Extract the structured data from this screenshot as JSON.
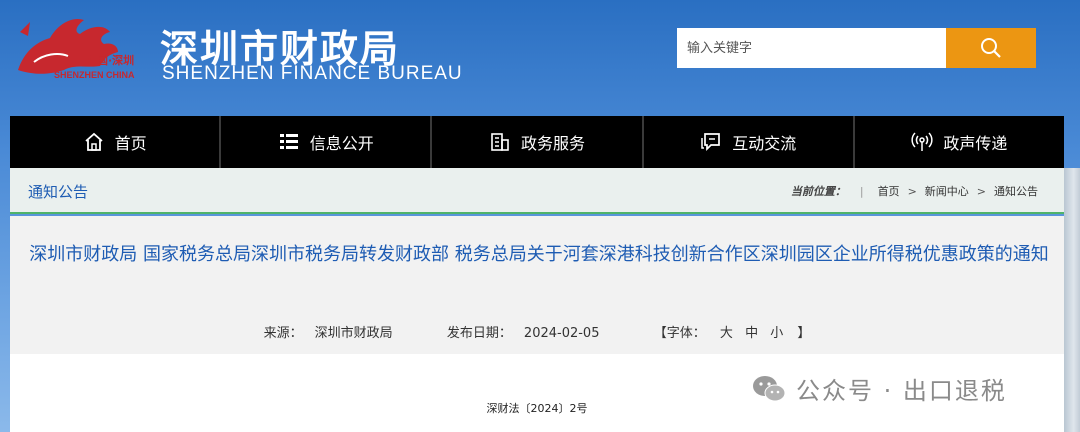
{
  "header": {
    "logo_text_cn": "中国·深圳",
    "logo_text_en": "SHENZHEN CHINA",
    "title_cn": "深圳市财政局",
    "title_en": "SHENZHEN FINANCE BUREAU"
  },
  "search": {
    "placeholder": "输入关键字",
    "button_icon": "search-icon"
  },
  "nav": {
    "items": [
      {
        "label": "首页",
        "icon": "home-icon"
      },
      {
        "label": "信息公开",
        "icon": "list-icon"
      },
      {
        "label": "政务服务",
        "icon": "building-icon"
      },
      {
        "label": "互动交流",
        "icon": "chat-icon"
      },
      {
        "label": "政声传递",
        "icon": "broadcast-icon"
      }
    ]
  },
  "breadcrumb": {
    "section_title": "通知公告",
    "label": "当前位置：",
    "items": [
      "首页",
      "新闻中心",
      "通知公告"
    ],
    "separator": ">"
  },
  "article": {
    "title": "深圳市财政局 国家税务总局深圳市税务局转发财政部 税务总局关于河套深港科技创新合作区深圳园区企业所得税优惠政策的通知",
    "source_label": "来源：",
    "source": "深圳市财政局",
    "date_label": "发布日期：",
    "date": "2024-02-05",
    "font_open": "【字体：",
    "font_sizes": [
      "大",
      "中",
      "小"
    ],
    "font_close": "】",
    "doc_number": "深财法〔2024〕2号"
  },
  "watermark": {
    "text": "公众号 · 出口退税"
  },
  "colors": {
    "link_blue": "#1e5cb3",
    "search_orange": "#ec9612",
    "nav_black": "#000000",
    "accent_green": "#4fb36a"
  }
}
